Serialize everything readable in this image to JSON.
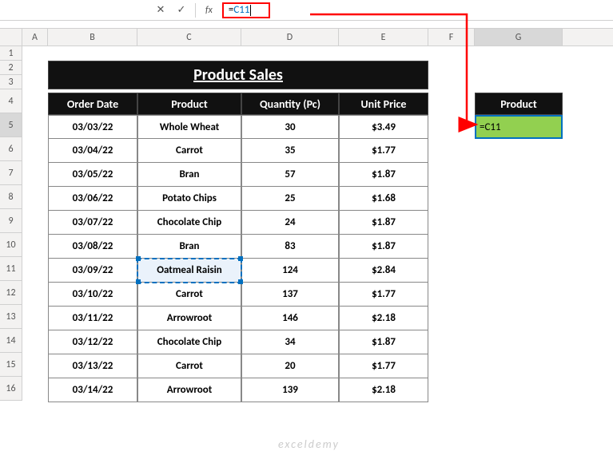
{
  "formula_bar": {
    "cancel_icon": "✕",
    "confirm_icon": "✓",
    "fx_label": "fx",
    "formula_equals": "=",
    "formula_ref": "C11"
  },
  "columns": [
    "A",
    "B",
    "C",
    "D",
    "E",
    "F",
    "G"
  ],
  "row_numbers": [
    1,
    2,
    3,
    4,
    5,
    6,
    7,
    8,
    9,
    10,
    11,
    12,
    13,
    14,
    15,
    16
  ],
  "title": "Product Sales",
  "headers": {
    "order": "Order Date",
    "product": "Product",
    "qty": "Quantity (Pc)",
    "price": "Unit Price"
  },
  "g_header": "Product",
  "g5_value": "=C11",
  "rows": [
    {
      "order": "03/03/22",
      "product": "Whole Wheat",
      "qty": "30",
      "price": "$3.49"
    },
    {
      "order": "03/04/22",
      "product": "Carrot",
      "qty": "35",
      "price": "$1.77"
    },
    {
      "order": "03/05/22",
      "product": "Bran",
      "qty": "57",
      "price": "$1.87"
    },
    {
      "order": "03/06/22",
      "product": "Potato Chips",
      "qty": "25",
      "price": "$1.68"
    },
    {
      "order": "03/07/22",
      "product": "Chocolate Chip",
      "qty": "24",
      "price": "$1.87"
    },
    {
      "order": "03/08/22",
      "product": "Bran",
      "qty": "83",
      "price": "$1.87"
    },
    {
      "order": "03/09/22",
      "product": "Oatmeal Raisin",
      "qty": "124",
      "price": "$2.84"
    },
    {
      "order": "03/10/22",
      "product": "Carrot",
      "qty": "137",
      "price": "$1.77"
    },
    {
      "order": "03/11/22",
      "product": "Arrowroot",
      "qty": "146",
      "price": "$2.18"
    },
    {
      "order": "03/12/22",
      "product": "Chocolate Chip",
      "qty": "34",
      "price": "$1.87"
    },
    {
      "order": "03/13/22",
      "product": "Carrot",
      "qty": "20",
      "price": "$1.77"
    },
    {
      "order": "03/14/22",
      "product": "Arrowroot",
      "qty": "139",
      "price": "$2.18"
    }
  ],
  "watermark": "exceldemy",
  "active_col": "G",
  "active_row": 5,
  "ref_row_index": 6
}
